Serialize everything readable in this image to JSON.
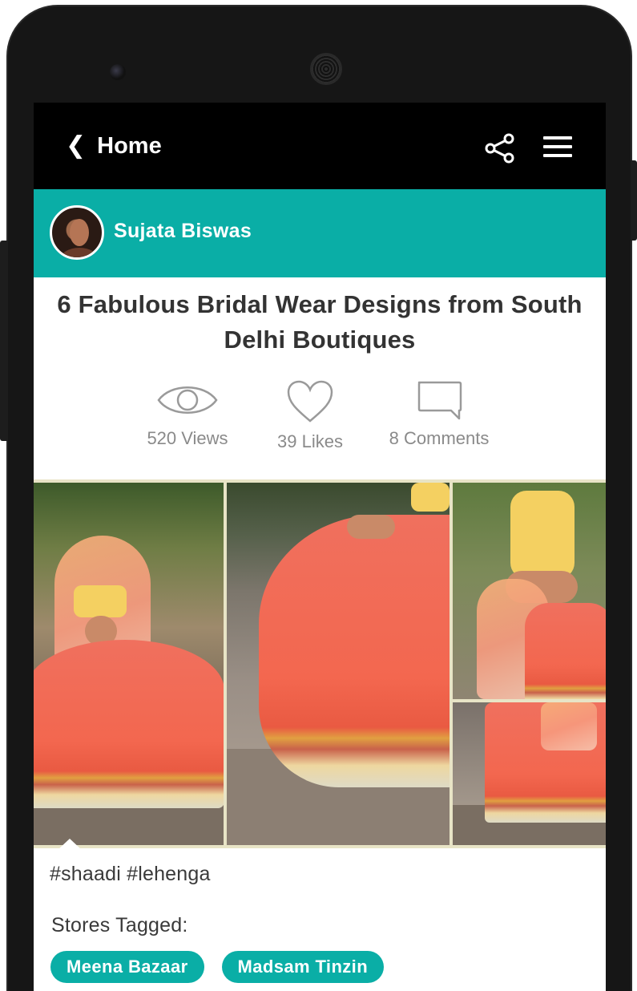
{
  "topbar": {
    "back_icon": "❮",
    "back_label": "Home",
    "share_icon": "share-icon",
    "menu_icon": "hamburger-menu-icon"
  },
  "author": {
    "name": "Sujata Biswas",
    "avatar": "avatar-photo"
  },
  "post": {
    "title": "6 Fabulous Bridal Wear Designs from South Delhi Boutiques",
    "stats": {
      "views": "520 Views",
      "likes": "39 Likes",
      "comments": "8 Comments"
    },
    "photos": [
      "bride-lehenga-with-veil",
      "lehenga-skirt-twirl",
      "lehenga-back-view",
      "lehenga-hem-detail"
    ],
    "hashtags": "#shaadi #lehenga",
    "stores_label": "Stores Tagged:",
    "stores": [
      "Meena Bazaar",
      "Madsam Tinzin"
    ]
  },
  "colors": {
    "accent": "#0aaea6",
    "topbar": "#000000",
    "text": "#333333",
    "muted": "#8a8a8a"
  }
}
